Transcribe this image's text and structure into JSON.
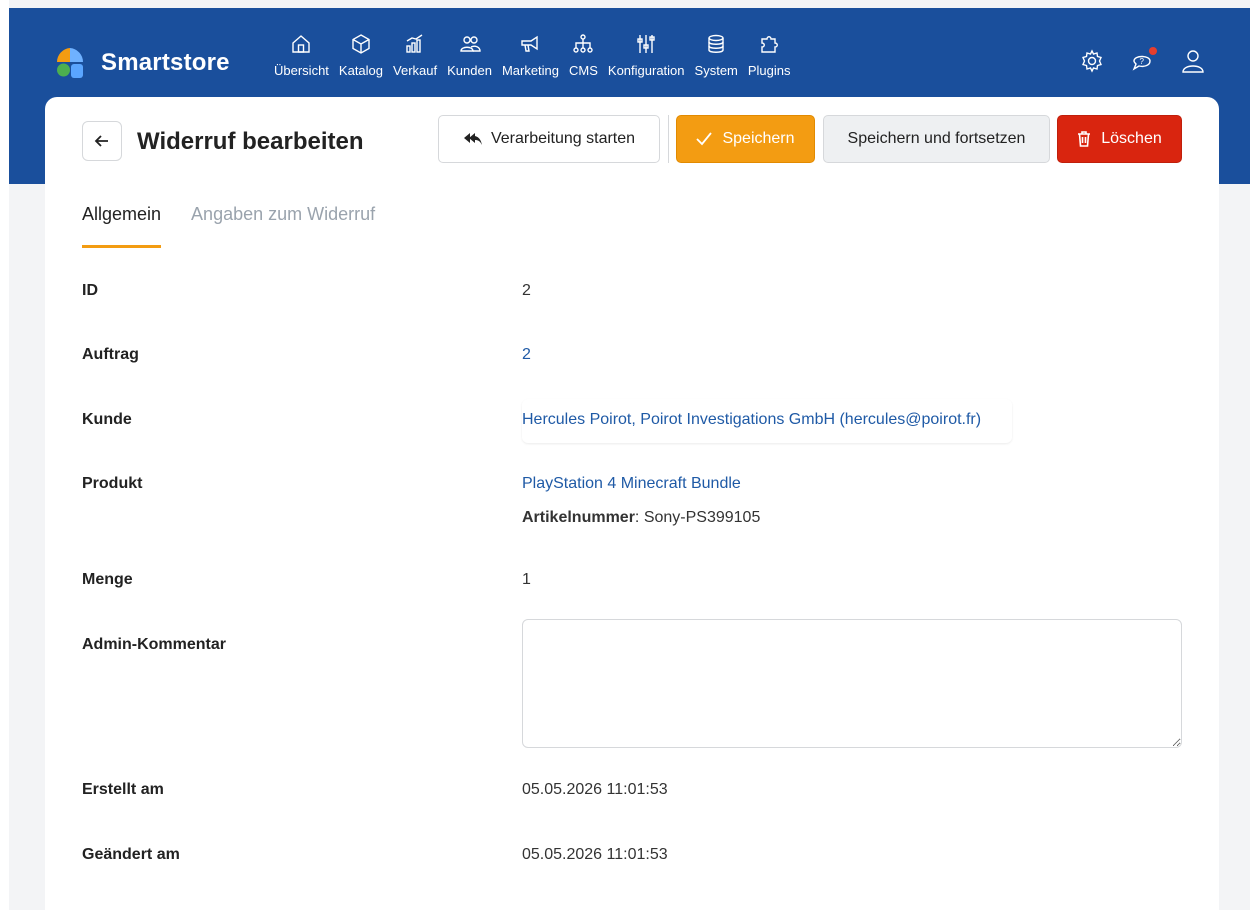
{
  "app": {
    "name": "Smartstore"
  },
  "nav": [
    {
      "label": "Übersicht",
      "icon": "home-icon"
    },
    {
      "label": "Katalog",
      "icon": "box-icon"
    },
    {
      "label": "Verkauf",
      "icon": "chart-icon"
    },
    {
      "label": "Kunden",
      "icon": "people-icon"
    },
    {
      "label": "Marketing",
      "icon": "megaphone-icon"
    },
    {
      "label": "CMS",
      "icon": "sitemap-icon"
    },
    {
      "label": "Konfiguration",
      "icon": "sliders-icon"
    },
    {
      "label": "System",
      "icon": "database-icon"
    },
    {
      "label": "Plugins",
      "icon": "puzzle-icon"
    }
  ],
  "header": {
    "title": "Widerruf bearbeiten",
    "process_label": "Verarbeitung starten",
    "save_label": "Speichern",
    "save_continue_label": "Speichern und fortsetzen",
    "delete_label": "Löschen"
  },
  "tabs": [
    {
      "label": "Allgemein",
      "active": true
    },
    {
      "label": "Angaben zum Widerruf",
      "active": false
    }
  ],
  "fields": {
    "id": {
      "label": "ID",
      "value": "2"
    },
    "order": {
      "label": "Auftrag",
      "value": "2"
    },
    "customer": {
      "label": "Kunde",
      "value": "Hercules Poirot, Poirot Investigations GmbH  (hercules@poirot.fr)"
    },
    "product": {
      "label": "Produkt",
      "value": "PlayStation 4 Minecraft Bundle",
      "sku_label": "Artikelnummer",
      "sku_value": ": Sony-PS399105"
    },
    "quantity": {
      "label": "Menge",
      "value": "1"
    },
    "admin_comment": {
      "label": "Admin-Kommentar",
      "value": ""
    },
    "created": {
      "label": "Erstellt am",
      "value": "05.05.2026 11:01:53"
    },
    "updated": {
      "label": "Geändert am",
      "value": "05.05.2026 11:01:53"
    }
  },
  "colors": {
    "brand": "#1a4f9c",
    "accent": "#f39c12",
    "danger": "#d9250f",
    "link": "#1f5aa6"
  }
}
